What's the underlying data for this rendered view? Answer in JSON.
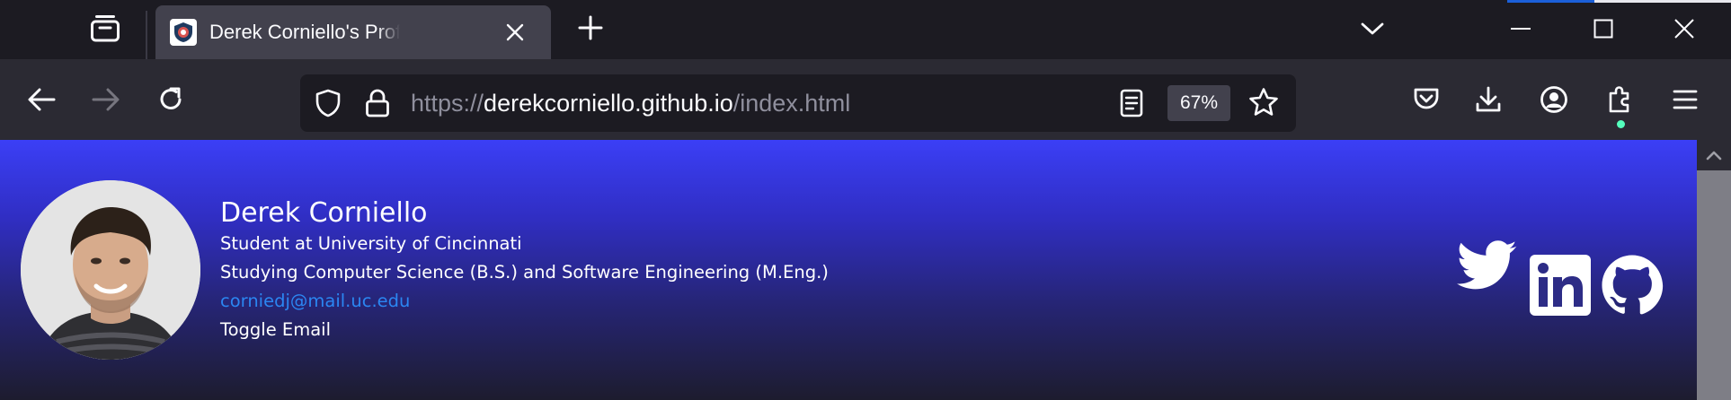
{
  "browser": {
    "tab": {
      "title": "Derek Corniello's Professional Website",
      "favicon": "shield-logo-icon"
    },
    "url": {
      "scheme": "https://",
      "host": "derekcorniello.github.io",
      "path": "/index.html"
    },
    "zoom": "67%",
    "icons": {
      "tab_overview": "tab-overview-icon",
      "new_tab": "plus-icon",
      "list_tabs": "chevron-down-icon",
      "back": "arrow-left-icon",
      "forward": "arrow-right-icon",
      "reload": "reload-icon",
      "tracking_protection": "shield-icon",
      "security": "lock-icon",
      "reader_view": "reader-view-icon",
      "bookmark": "star-icon",
      "pocket": "pocket-icon",
      "downloads": "download-icon",
      "account": "account-icon",
      "extensions": "puzzle-icon",
      "menu": "hamburger-icon"
    }
  },
  "profile": {
    "name": "Derek Corniello",
    "subtitle": "Student at University of Cincinnati",
    "study": "Studying Computer Science (B.S.) and Software Engineering (M.Eng.)",
    "email": "corniedj@mail.uc.edu",
    "toggle_email_label": "Toggle Email"
  },
  "social": {
    "twitter": "twitter-icon",
    "linkedin": "linkedin-icon",
    "github": "github-icon"
  },
  "colors": {
    "gradient_top": "#3b3ff6",
    "gradient_bottom": "#1d1c2e",
    "email_link": "#2b86f2",
    "browser_chrome": "#2b2a33",
    "tab_active": "#42414d"
  }
}
